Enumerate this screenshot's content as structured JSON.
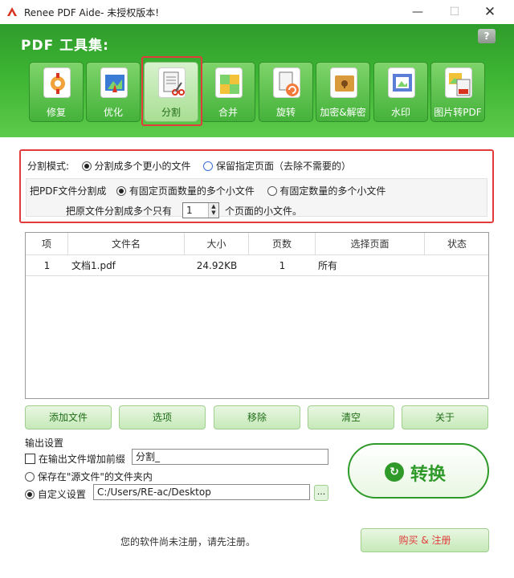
{
  "window": {
    "title": "Renee PDF Aide- 未授权版本!",
    "minimize": "—",
    "maximize": "☐",
    "close": "✕"
  },
  "header": {
    "title": "PDF 工具集:",
    "help": "?"
  },
  "tools": [
    {
      "label": "修复",
      "icon": "repair-icon",
      "selected": false
    },
    {
      "label": "优化",
      "icon": "optimize-icon",
      "selected": false
    },
    {
      "label": "分割",
      "icon": "split-icon",
      "selected": true
    },
    {
      "label": "合并",
      "icon": "merge-icon",
      "selected": false
    },
    {
      "label": "旋转",
      "icon": "rotate-icon",
      "selected": false
    },
    {
      "label": "加密&解密",
      "icon": "encrypt-icon",
      "selected": false
    },
    {
      "label": "水印",
      "icon": "watermark-icon",
      "selected": false
    },
    {
      "label": "图片转PDF",
      "icon": "image-to-pdf-icon",
      "selected": false
    }
  ],
  "split": {
    "mode_label": "分割模式:",
    "mode_option_1": "分割成多个更小的文件",
    "mode_option_2": "保留指定页面（去除不需要的）",
    "into_label": "把PDF文件分割成",
    "into_option_1": "有固定页面数量的多个小文件",
    "into_option_2": "有固定数量的多个小文件",
    "pages_prefix": "把原文件分割成多个只有",
    "pages_value": "1",
    "pages_suffix": "个页面的小文件。"
  },
  "table": {
    "headers": [
      "项",
      "文件名",
      "大小",
      "页数",
      "选择页面",
      "状态"
    ],
    "rows": [
      {
        "index": "1",
        "name": "文档1.pdf",
        "size": "24.92KB",
        "pages": "1",
        "selection": "所有",
        "status": ""
      }
    ]
  },
  "actions": {
    "add": "添加文件",
    "options": "选项",
    "remove": "移除",
    "clear": "清空",
    "about": "关于"
  },
  "output": {
    "title": "输出设置",
    "prefix_label": "在输出文件增加前缀",
    "prefix_value": "分割_",
    "save_source_label": "保存在\"源文件\"的文件夹内",
    "custom_label": "自定义设置",
    "custom_path": "C:/Users/RE-ac/Desktop",
    "browse": "..."
  },
  "convert": {
    "label": "转换"
  },
  "footer": {
    "register_notice": "您的软件尚未注册，请先注册。",
    "buy_label": "购买 & 注册"
  },
  "colors": {
    "header_green": "#3db433",
    "accent_green": "#2f9a2a",
    "highlight_red": "#e23b3b"
  }
}
